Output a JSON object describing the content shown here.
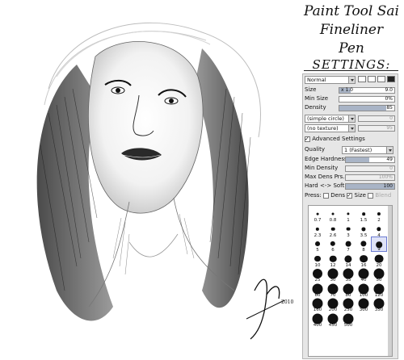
{
  "title_lines": [
    "Paint Tool Sai",
    "Fineliner",
    "Pen"
  ],
  "settings_heading": "SETTINGS:",
  "blend_mode": "Normal",
  "size": {
    "label": "Size",
    "multiplier": "x 1.0",
    "value": "9.0",
    "fill": 0.2
  },
  "min_size": {
    "label": "Min Size",
    "value": "0%",
    "fill": 0.0
  },
  "density": {
    "label": "Density",
    "value": "85",
    "fill": 0.85
  },
  "shape_dropdown": "(simple circle)",
  "shape_value": "0",
  "texture_dropdown": "(no texture)",
  "texture_value": "95",
  "advanced_settings": "Advanced Settings",
  "quality": {
    "label": "Quality",
    "value": "1 (Fastest)"
  },
  "edge_hardness": {
    "label": "Edge Hardness",
    "value": "49",
    "fill": 0.49
  },
  "min_density": {
    "label": "Min Density",
    "value": "0"
  },
  "max_dens_prs": {
    "label": "Max Dens Prs.",
    "value": "100%"
  },
  "hard_soft": {
    "label": "Hard <-> Soft",
    "value": "100",
    "fill": 1.0
  },
  "press": {
    "label": "Press:",
    "dens": "Dens",
    "size": "Size",
    "blend": "Blend"
  },
  "brush_sizes": [
    "0.7",
    "0.8",
    "1",
    "1.5",
    "2",
    "2.3",
    "2.6",
    "3",
    "3.5",
    "4",
    "5",
    "6",
    "7",
    "8",
    "9",
    "10",
    "12",
    "14",
    "16",
    "20",
    "25",
    "30",
    "35",
    "40",
    "50",
    "60",
    "70",
    "80",
    "100",
    "120",
    "160",
    "200",
    "250",
    "300",
    "350",
    "400",
    "450",
    "500"
  ],
  "selected_brush": "9",
  "signature": "2010"
}
